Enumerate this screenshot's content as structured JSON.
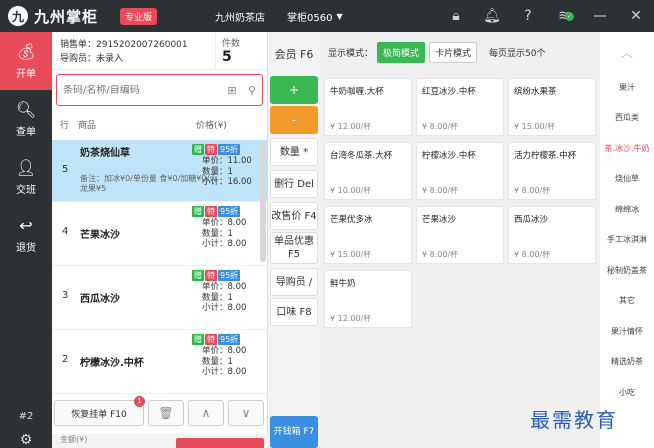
{
  "topbar": {
    "logo_text": "九州掌柜",
    "badge": "专业版",
    "store": "九州奶茶店",
    "station": "掌柜0560"
  },
  "nav": {
    "items": [
      {
        "label": "开单",
        "icon": "bag-icon"
      },
      {
        "label": "查单",
        "icon": "search-doc-icon"
      },
      {
        "label": "交班",
        "icon": "user-icon"
      },
      {
        "label": "退货",
        "icon": "return-icon"
      }
    ],
    "footer": "#2"
  },
  "order": {
    "sales_no": "销售单：2915202007260001",
    "guide": "导购员：未录入",
    "count_label": "件数",
    "count": "5",
    "search_placeholder": "条码/名称/自编码",
    "col_line": "行",
    "col_product": "商品",
    "col_price": "价格(¥)",
    "rows": [
      {
        "no": "5",
        "name": "奶茶烧仙草",
        "note": "备注：加冰¥0/单份量 食¥0/加糖¥0/火龙果¥5",
        "price": "单价：11.00",
        "qty": "数量：1",
        "subtotal": "小计：16.00"
      },
      {
        "no": "4",
        "name": "芒果冰沙",
        "note": "",
        "price": "单价：8.00",
        "qty": "数量：1",
        "subtotal": "小计：8.00"
      },
      {
        "no": "3",
        "name": "西瓜冰沙",
        "note": "",
        "price": "单价：8.00",
        "qty": "数量：1",
        "subtotal": "小计：8.00"
      },
      {
        "no": "2",
        "name": "柠檬冰沙.中杯",
        "note": "",
        "price": "单价：8.00",
        "qty": "数量：1",
        "subtotal": "小计：8.00"
      }
    ],
    "tags": {
      "t1": "赠",
      "t2": "特",
      "t3": "95折"
    },
    "restore_label": "恢复挂单 F10",
    "restore_badge": "1",
    "amount_label": "金额(¥)"
  },
  "funcs": {
    "member": "会员 F6",
    "plus": "+",
    "minus": "-",
    "qty": "数量 *",
    "delete": "删行 Del",
    "change_price": "改售价 F4",
    "single_discount": "单品优惠 F5",
    "guide": "导购员 /",
    "taste": "口味 F8",
    "open_drawer": "开钱箱 F7"
  },
  "grid": {
    "mode_label": "显示模式：",
    "mode_simple": "极简模式",
    "mode_card": "卡片模式",
    "per_page": "每页显示50个",
    "products": [
      {
        "name": "牛奶咖喱.大杯",
        "price": "¥ 12.00/杯"
      },
      {
        "name": "红豆冰沙.中杯",
        "price": "¥ 8.00/杯"
      },
      {
        "name": "缤纷水果茶",
        "price": "¥ 15.00/杯"
      },
      {
        "name": "台湾冬瓜茶.大杯",
        "price": "¥ 10.00/杯"
      },
      {
        "name": "柠檬冰沙.中杯",
        "price": "¥ 8.00/杯"
      },
      {
        "name": "活力柠檬茶.中杯",
        "price": "¥ 8.00/杯"
      },
      {
        "name": "芒果优多冰",
        "price": "¥ 15.00/杯"
      },
      {
        "name": "芒果冰沙",
        "price": "¥ 8.00/杯"
      },
      {
        "name": "西瓜冰沙",
        "price": "¥ 8.00/杯"
      },
      {
        "name": "鲜牛奶",
        "price": "¥ 12.00/杯"
      }
    ]
  },
  "categories": [
    "果汁",
    "西瓜类",
    "茶.冰沙.牛奶",
    "烧仙草",
    "绵绵冰",
    "手工冰淇淋",
    "秘制奶盖茶",
    "其它",
    "果汁情怀",
    "精选奶茶",
    "小吃"
  ],
  "watermark": "最需教育"
}
